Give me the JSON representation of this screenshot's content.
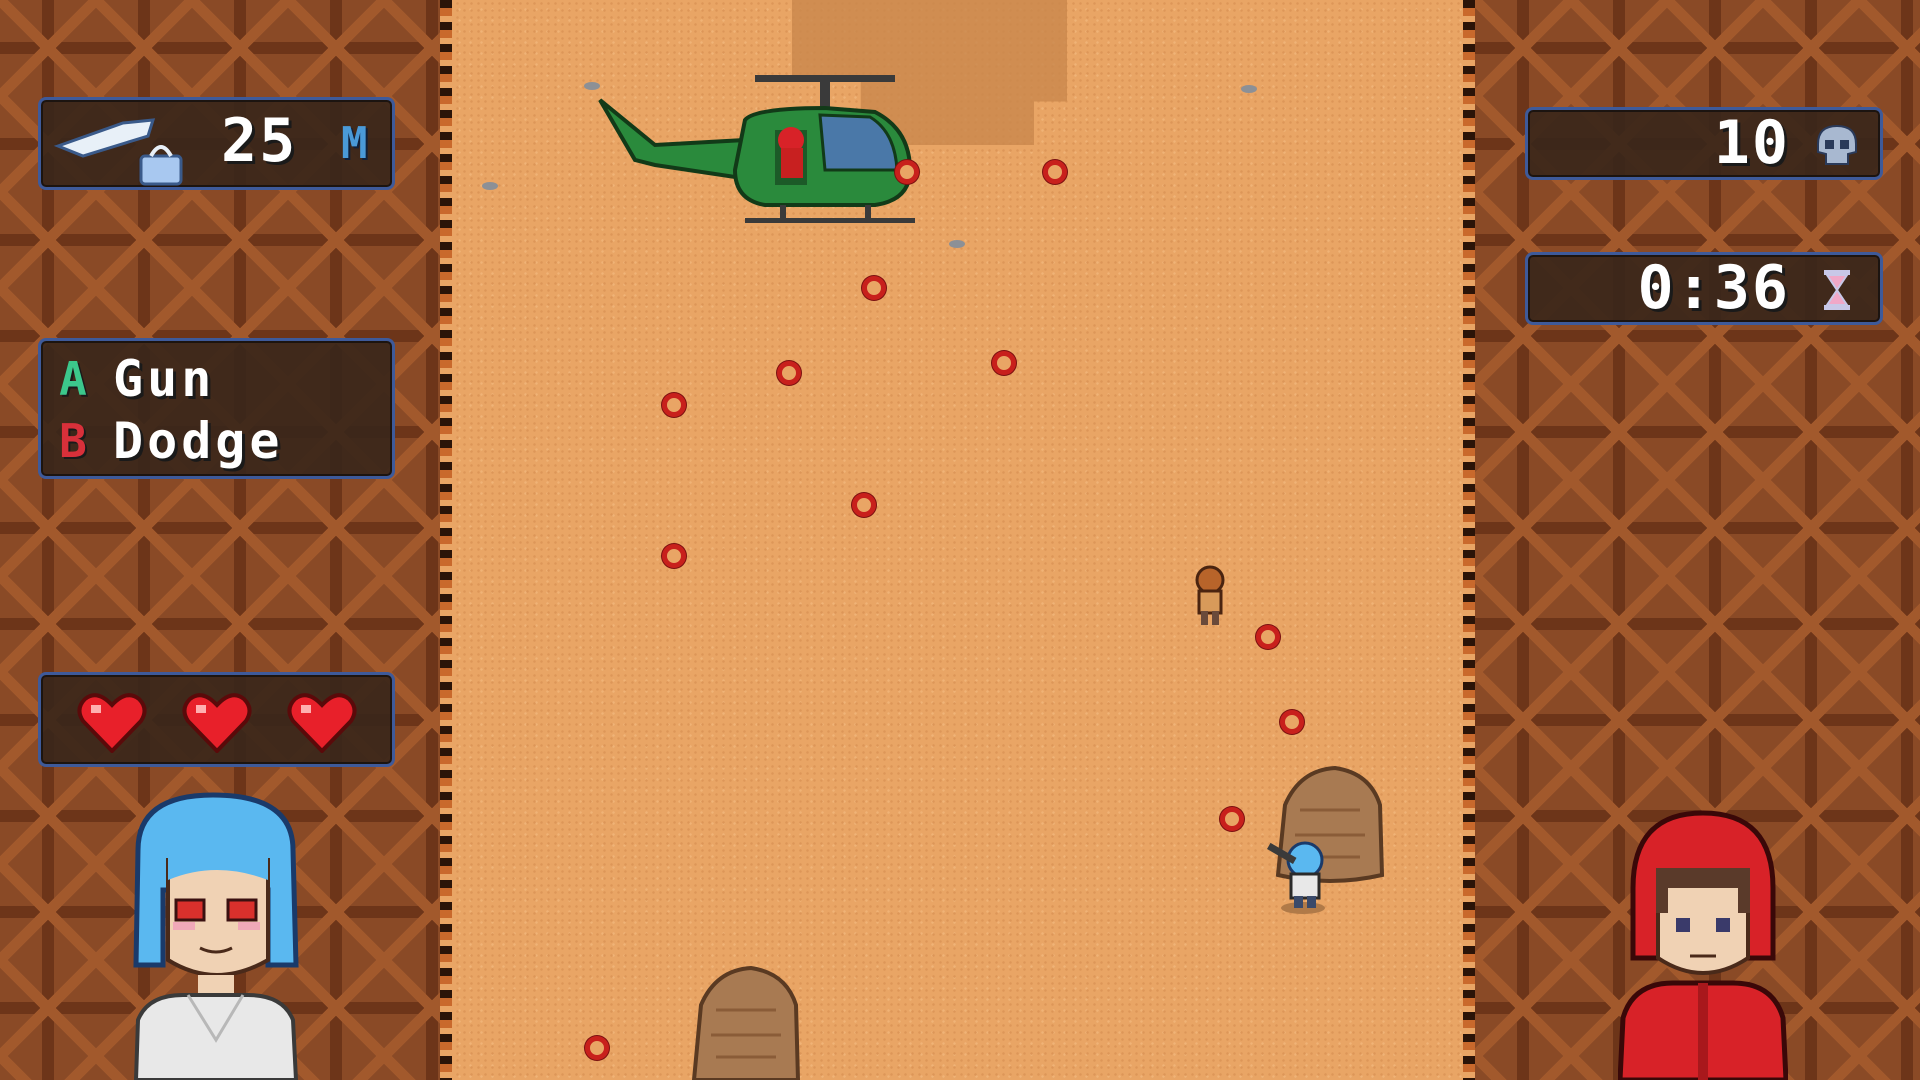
{
  "hud": {
    "distance": {
      "value": "25",
      "unit": "M",
      "icon": "flight-ticket-icon"
    },
    "controls": [
      {
        "key": "A",
        "label": "Gun",
        "color": "#3cc88c"
      },
      {
        "key": "B",
        "label": "Dodge",
        "color": "#d8303a"
      }
    ],
    "lives": {
      "count": 3,
      "max": 3,
      "icon": "heart-icon",
      "color": "#e8202a"
    },
    "kills": {
      "value": "10",
      "icon": "skull-icon"
    },
    "timer": {
      "value": "0:36",
      "icon": "hourglass-icon"
    }
  },
  "characters": {
    "player_portrait": {
      "hair": "#5ab8f0",
      "eyes": "#d8302c"
    },
    "enemy_portrait": {
      "hood": "#d82228"
    }
  },
  "colors": {
    "sand": "#e9a565",
    "panel": "#8a4a26",
    "helicopter": "#2a8a3c",
    "bullet": "#c8201c"
  }
}
